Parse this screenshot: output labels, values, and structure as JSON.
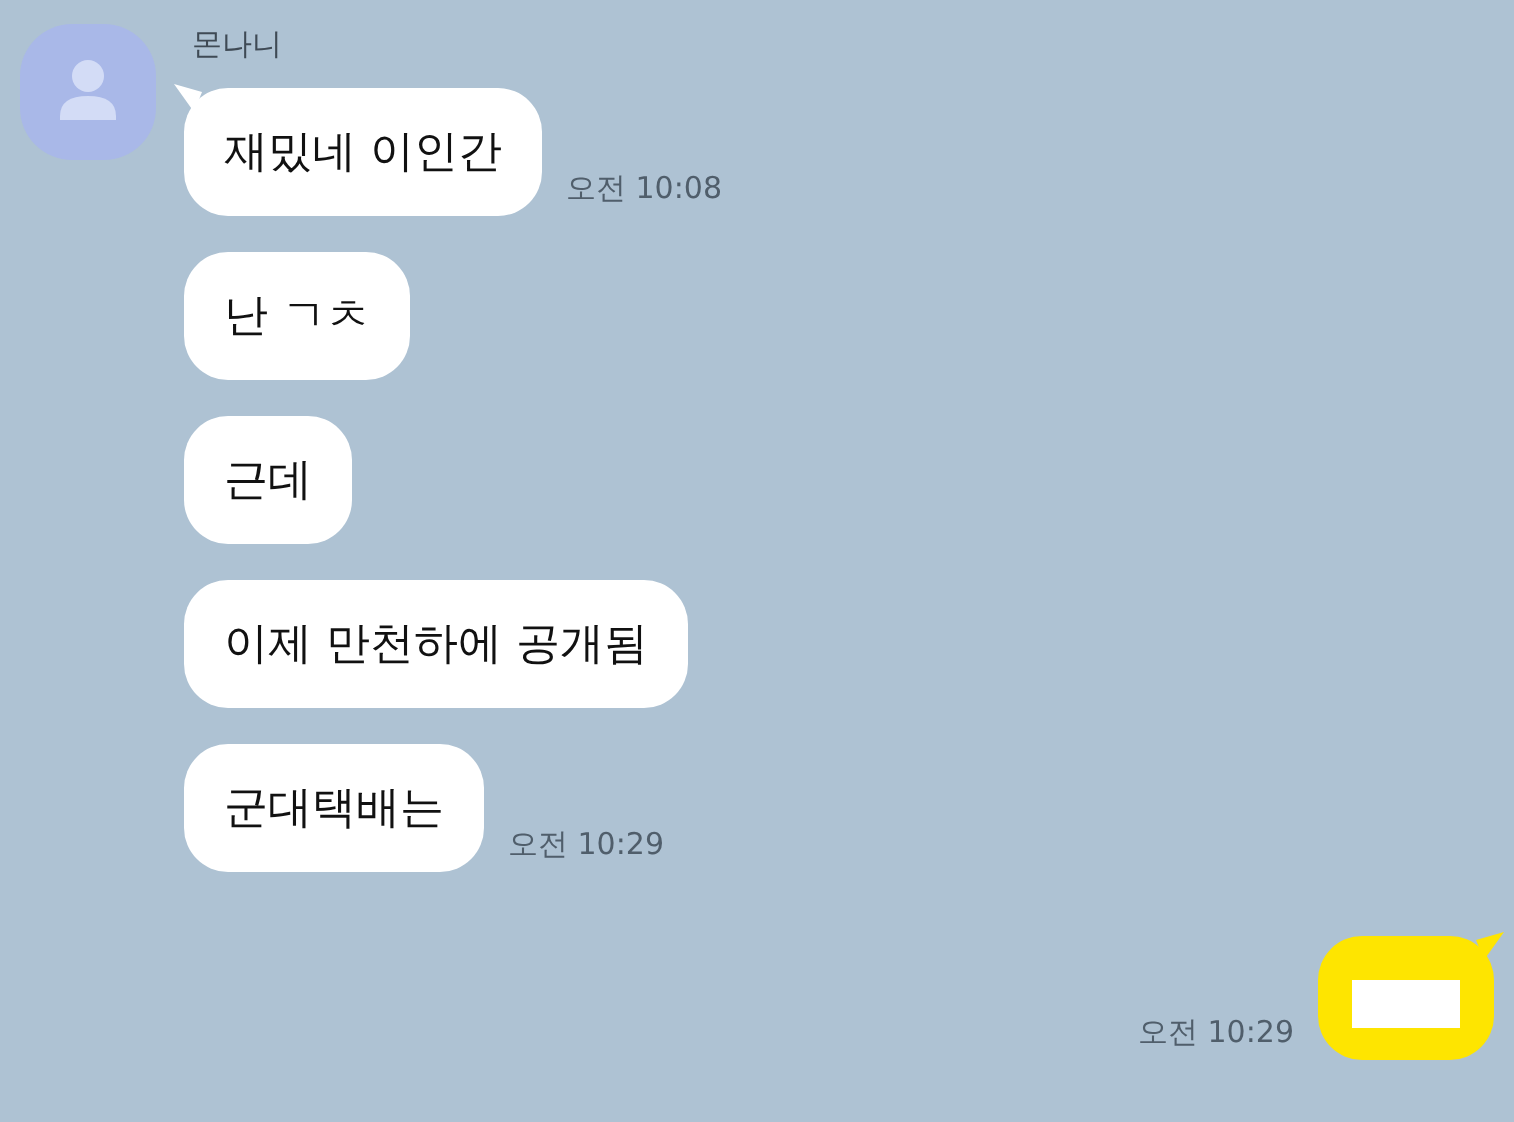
{
  "sender": {
    "name": "몬나니"
  },
  "messages": [
    {
      "text": "재밌네 이인간",
      "time": "오전 10:08"
    },
    {
      "text": "난 ㄱㅊ"
    },
    {
      "text": "근데"
    },
    {
      "text": "이제 만천하에 공개됨"
    },
    {
      "text": "군대택배는",
      "time": "오전 10:29"
    }
  ],
  "reply": {
    "time": "오전 10:29",
    "redacted": true
  }
}
